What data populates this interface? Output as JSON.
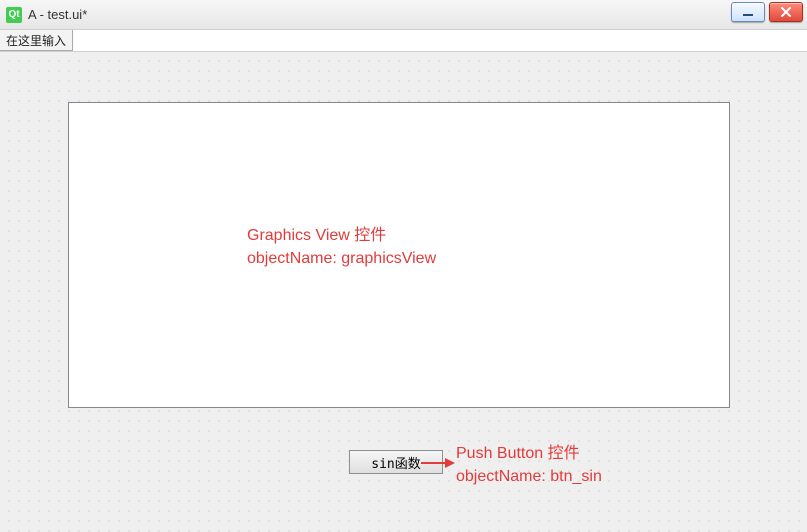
{
  "window": {
    "icon_label": "Qt",
    "title": "A - test.ui*"
  },
  "menubar": {
    "type_here_placeholder": "在这里输入"
  },
  "widgets": {
    "graphics_view": {
      "objectName": "graphicsView"
    },
    "push_button": {
      "label": "sin函数",
      "objectName": "btn_sin"
    }
  },
  "annotations": {
    "graphics_view_line1": "Graphics View 控件",
    "graphics_view_line2": "objectName: graphicsView",
    "push_button_line1": "Push Button 控件",
    "push_button_line2": "objectName: btn_sin"
  },
  "watermark": ""
}
